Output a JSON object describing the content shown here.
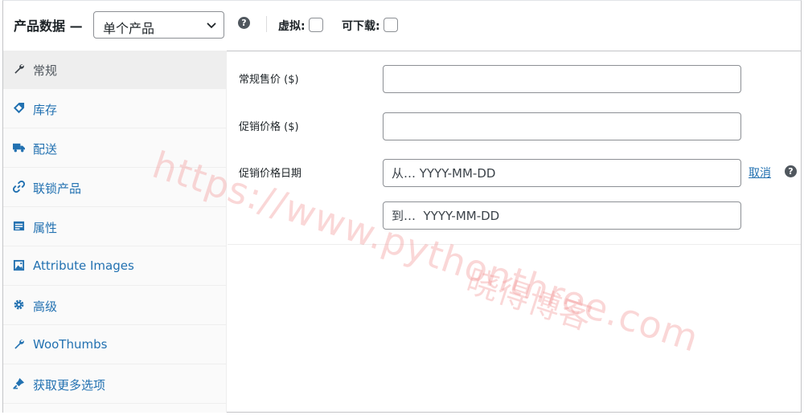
{
  "header": {
    "title": "产品数据 —",
    "product_type": {
      "selected": "单个产品"
    },
    "virtual_label": "虚拟:",
    "downloadable_label": "可下载:",
    "help_glyph": "?"
  },
  "sidebar": {
    "items": [
      {
        "label": "常规",
        "icon": "wrench-icon",
        "active": true
      },
      {
        "label": "库存",
        "icon": "tag-icon"
      },
      {
        "label": "配送",
        "icon": "truck-icon"
      },
      {
        "label": "联锁产品",
        "icon": "link-icon"
      },
      {
        "label": "属性",
        "icon": "list-icon"
      },
      {
        "label": "Attribute Images",
        "icon": "image-icon"
      },
      {
        "label": "高级",
        "icon": "gear-icon"
      },
      {
        "label": "WooThumbs",
        "icon": "wrench-icon"
      },
      {
        "label": "获取更多选项",
        "icon": "plugin-icon"
      }
    ]
  },
  "general": {
    "regular_price_label": "常规售价 ($)",
    "regular_price_value": "",
    "sale_price_label": "促销价格 ($)",
    "sale_price_value": "",
    "sale_dates_label": "促销价格日期",
    "date_from_placeholder": "从… YYYY-MM-DD",
    "date_to_placeholder": "到…  YYYY-MM-DD",
    "cancel_link": "取消"
  },
  "watermark": {
    "url": "https://www.pythonthree.com",
    "name": "晓得博客"
  },
  "colors": {
    "link": "#2271b1",
    "border": "#8c8f94",
    "watermark": "#f08c8c"
  }
}
